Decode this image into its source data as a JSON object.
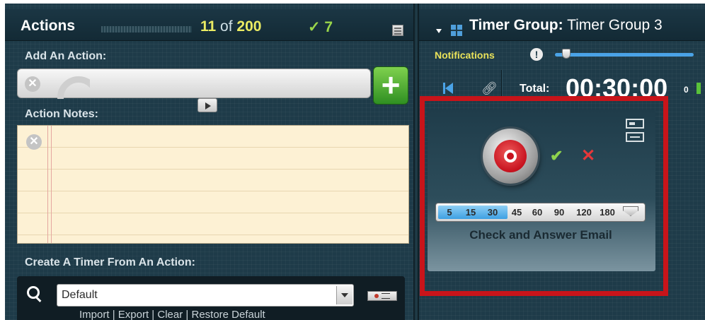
{
  "actions_panel": {
    "title": "Actions",
    "count_current": "11",
    "count_sep": "of",
    "count_total": "200",
    "completed_count": "✓ 7",
    "add_action_label": "Add An Action:",
    "add_button_label": "+",
    "notes_label": "Action Notes:",
    "create_timer_label": "Create A Timer From An Action:",
    "timer_select_value": "Default",
    "links": [
      "Import",
      "Export",
      "Clear",
      "Restore Default"
    ],
    "link_separator": "|"
  },
  "timer_group": {
    "title_prefix": "Timer Group:",
    "title_value": "Timer Group 3",
    "notifications_label": "Notifications",
    "alert_glyph": "!",
    "total_label": "Total:",
    "total_time": "00:30:00",
    "counter": "0"
  },
  "timer_card": {
    "task_name": "Check and Answer Email",
    "done_glyph": "✔",
    "cancel_glyph": "✕",
    "duration_options": [
      "5",
      "15",
      "30",
      "45",
      "60",
      "90",
      "120",
      "180"
    ],
    "selected_duration": "30"
  },
  "colors": {
    "background": "#1e3b49",
    "count_highlight": "#eaeb63",
    "check_green": "#9ad64a",
    "notifications_yellow": "#e9e25a",
    "slider_blue": "#4aa3e7",
    "highlight_red": "#c8141a",
    "add_green": "#3fa02c"
  },
  "icons": [
    "list-view-icon",
    "rss-icon",
    "clear-icon",
    "expand-arrow-icon",
    "search-icon",
    "dropdown-arrow-icon",
    "record-button-icon",
    "collapse-triangle-icon",
    "grid-icon",
    "alert-icon",
    "skip-back-icon",
    "link-icon",
    "compact-view-icon",
    "expand-width-icon"
  ]
}
